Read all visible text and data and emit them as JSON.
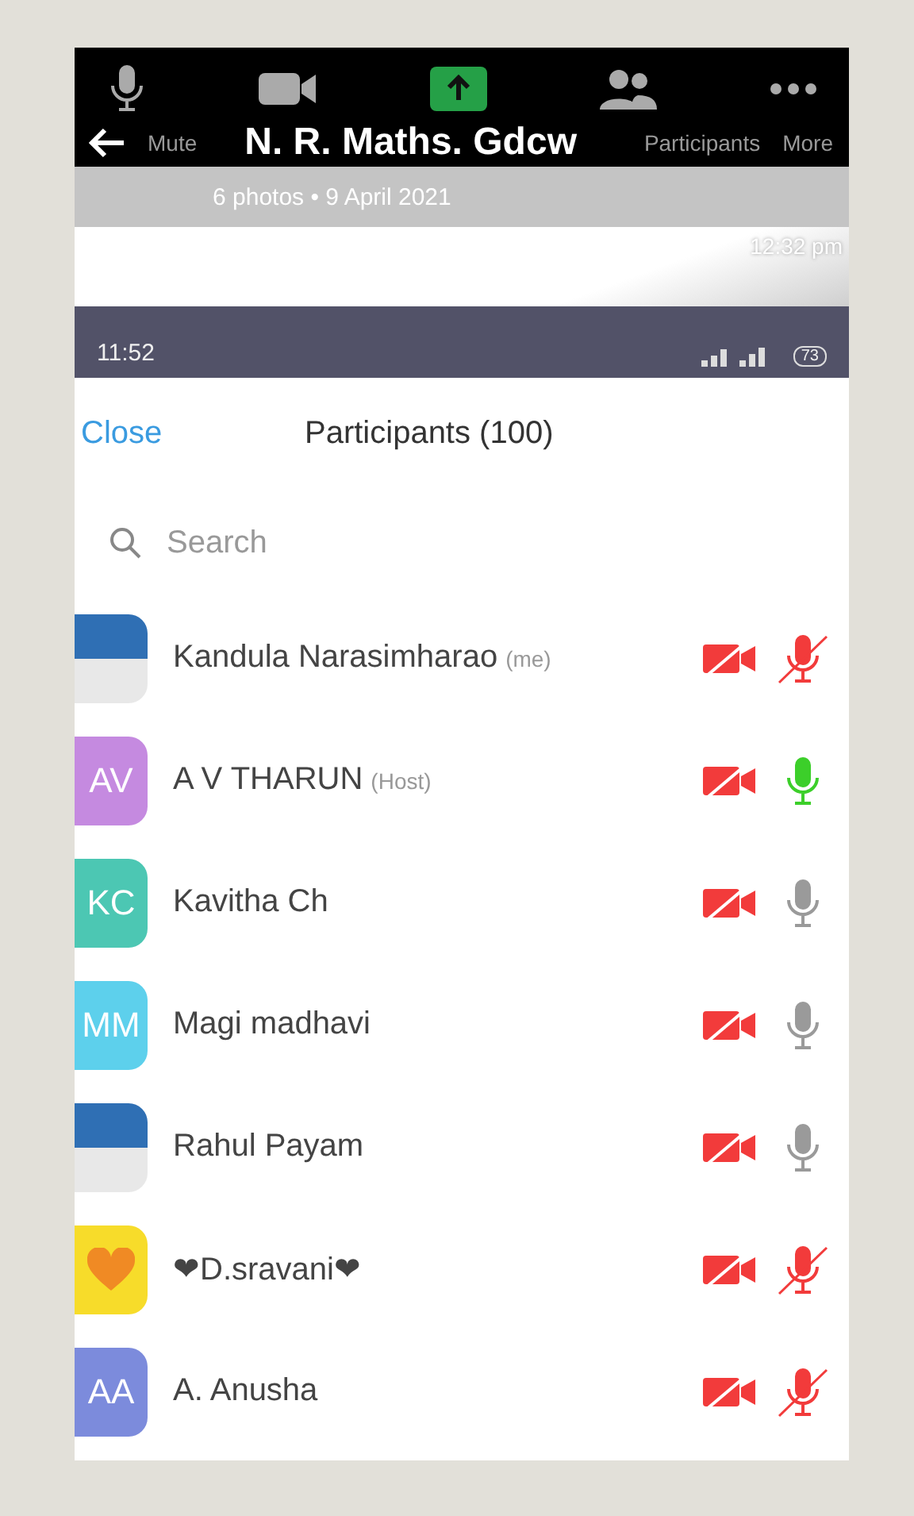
{
  "meeting_toolbar": {
    "items": [
      {
        "kind": "mic"
      },
      {
        "kind": "video"
      },
      {
        "kind": "share"
      },
      {
        "label": "Participants",
        "kind": "people"
      },
      {
        "label": "More",
        "kind": "more"
      }
    ],
    "mute_label": "Mute"
  },
  "gallery_header": {
    "title": "N. R. Maths. Gdcw",
    "subtitle": "6 photos • 9 April 2021",
    "timestamp": "12:32 pm"
  },
  "status_bar": {
    "time": "11:52",
    "battery": "73"
  },
  "header": {
    "close": "Close",
    "title": "Participants (100)"
  },
  "search": {
    "placeholder": "Search"
  },
  "participants": [
    {
      "name": "Kandula Narasimharao",
      "role": "(me)",
      "kind": "photo",
      "video_on": false,
      "muted": true
    },
    {
      "name": "A V THARUN",
      "role": "(Host)",
      "kind": "initials",
      "initials": "AV",
      "color": "#c58ae0",
      "video_on": false,
      "muted": false,
      "speaking": true
    },
    {
      "name": "Kavitha Ch",
      "kind": "initials",
      "initials": "KC",
      "color": "#4cc7b3",
      "video_on": false,
      "muted": false,
      "speaking": false
    },
    {
      "name": "Magi madhavi",
      "kind": "initials",
      "initials": "MM",
      "color": "#5dd0ec",
      "video_on": false,
      "muted": false,
      "speaking": false
    },
    {
      "name": "Rahul Payam",
      "kind": "photo",
      "video_on": false,
      "muted": false,
      "speaking": false
    },
    {
      "name": "❤D.sravani❤",
      "kind": "heart",
      "color": "#f7dc2a",
      "video_on": false,
      "muted": true
    },
    {
      "name": "A. Anusha",
      "kind": "initials",
      "initials": "AA",
      "color": "#7c8bdc",
      "video_on": false,
      "muted": true
    }
  ]
}
